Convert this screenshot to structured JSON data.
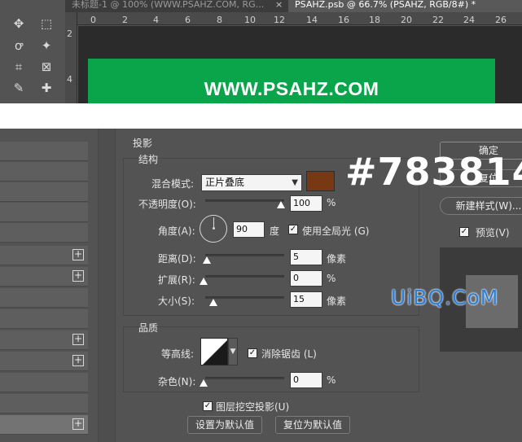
{
  "document_tabs": [
    {
      "label": "未标题-1 @ 100% (WWW.PSAHZ.COM, RG..."
    },
    {
      "label": "PSAHZ.psb @ 66.7% (PSAHZ, RGB/8#) *"
    }
  ],
  "tab_close": "×",
  "ruler_top": [
    "0",
    "2",
    "4",
    "6",
    "8",
    "10",
    "12",
    "14",
    "16",
    "18",
    "20",
    "22",
    "24",
    "26"
  ],
  "ruler_side": [
    "2",
    "4"
  ],
  "canvas": {
    "banner_text": "WWW.PSAHZ.COM",
    "banner_color": "#0aa54a"
  },
  "tools": [
    {
      "icon": "move-icon",
      "glyph": "✥"
    },
    {
      "icon": "marquee-icon",
      "glyph": "⬚"
    },
    {
      "icon": "lasso-icon",
      "glyph": "ꝍ"
    },
    {
      "icon": "magic-wand-icon",
      "glyph": "✦"
    },
    {
      "icon": "crop-icon",
      "glyph": "⌗"
    },
    {
      "icon": "frame-icon",
      "glyph": "⊠"
    },
    {
      "icon": "eyedropper-icon",
      "glyph": "✎"
    },
    {
      "icon": "healing-brush-icon",
      "glyph": "✚"
    }
  ],
  "dialog": {
    "section": "投影",
    "structure": {
      "title": "结构",
      "blend_mode_label": "混合模式:",
      "blend_mode_value": "正片叠底",
      "shadow_color": "#783814",
      "opacity_label": "不透明度(O):",
      "opacity_value": "100",
      "opacity_unit": "%",
      "opacity": 1.0,
      "angle_label": "角度(A):",
      "angle_value": "90",
      "angle_unit": "度",
      "global_light_label": "使用全局光 (G)",
      "global_light_checked": true,
      "distance_label": "距离(D):",
      "distance_value": "5",
      "distance_unit": "像素",
      "spread_label": "扩展(R):",
      "spread_value": "0",
      "spread_unit": "%",
      "size_label": "大小(S):",
      "size_value": "15",
      "size_unit": "像素"
    },
    "quality": {
      "title": "品质",
      "contour_label": "等高线:",
      "anti_alias_label": "消除锯齿 (L)",
      "anti_alias_checked": true,
      "noise_label": "杂色(N):",
      "noise_value": "0",
      "noise_unit": "%"
    },
    "knockout_label": "图层挖空投影(U)",
    "knockout_checked": true,
    "make_default_label": "设置为默认值",
    "reset_default_label": "复位为默认值",
    "buttons": {
      "ok": "确定",
      "cancel_partial": "复位",
      "new_style": "新建样式(W)...",
      "preview": "预览(V)"
    },
    "preview_checked": true,
    "check_mark": "✓",
    "plus": "+"
  },
  "hex_overlay": "#783814",
  "watermark": "UiBQ.CoM"
}
